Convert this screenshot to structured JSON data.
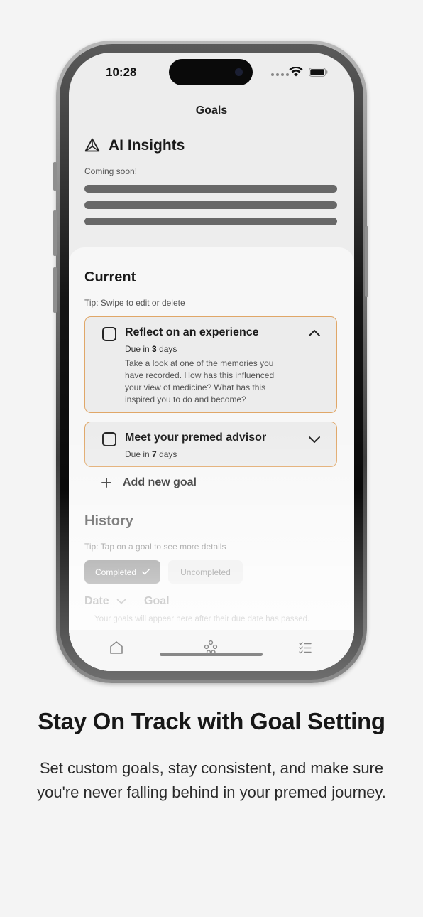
{
  "status_bar": {
    "time": "10:28"
  },
  "header": {
    "title": "Goals"
  },
  "ai_insights": {
    "title": "AI Insights",
    "subtitle": "Coming soon!",
    "icon": "triangle-network-icon"
  },
  "current": {
    "title": "Current",
    "tip": "Tip: Swipe to edit or delete",
    "goals": [
      {
        "title": "Reflect on an experience",
        "due_prefix": "Due in",
        "due_days": "3",
        "due_suffix": "days",
        "description": "Take a look at one of the memories you have recorded. How has this influenced your view of medicine? What has this inspired you to do and become?",
        "expanded": true
      },
      {
        "title": "Meet your premed advisor",
        "due_prefix": "Due in",
        "due_days": "7",
        "due_suffix": "days",
        "expanded": false
      }
    ],
    "add_label": "Add new goal"
  },
  "history": {
    "title": "History",
    "tip": "Tip: Tap on a goal to see more details",
    "filters": {
      "completed": "Completed",
      "uncompleted": "Uncompleted",
      "selected": "Completed"
    },
    "columns": {
      "date": "Date",
      "goal": "Goal"
    },
    "empty_note": "Your goals will appear here after their due date has passed."
  },
  "tabbar": {
    "icons": [
      "home-icon",
      "network-icon",
      "checklist-icon"
    ]
  },
  "colors": {
    "accent_border": "#e0a768",
    "skeleton": "#686868",
    "pill_selected": "#6b6b6b"
  },
  "marketing": {
    "headline": "Stay On Track with Goal Setting",
    "subcopy": "Set custom goals, stay consistent, and make sure you're never falling behind in your premed journey."
  }
}
